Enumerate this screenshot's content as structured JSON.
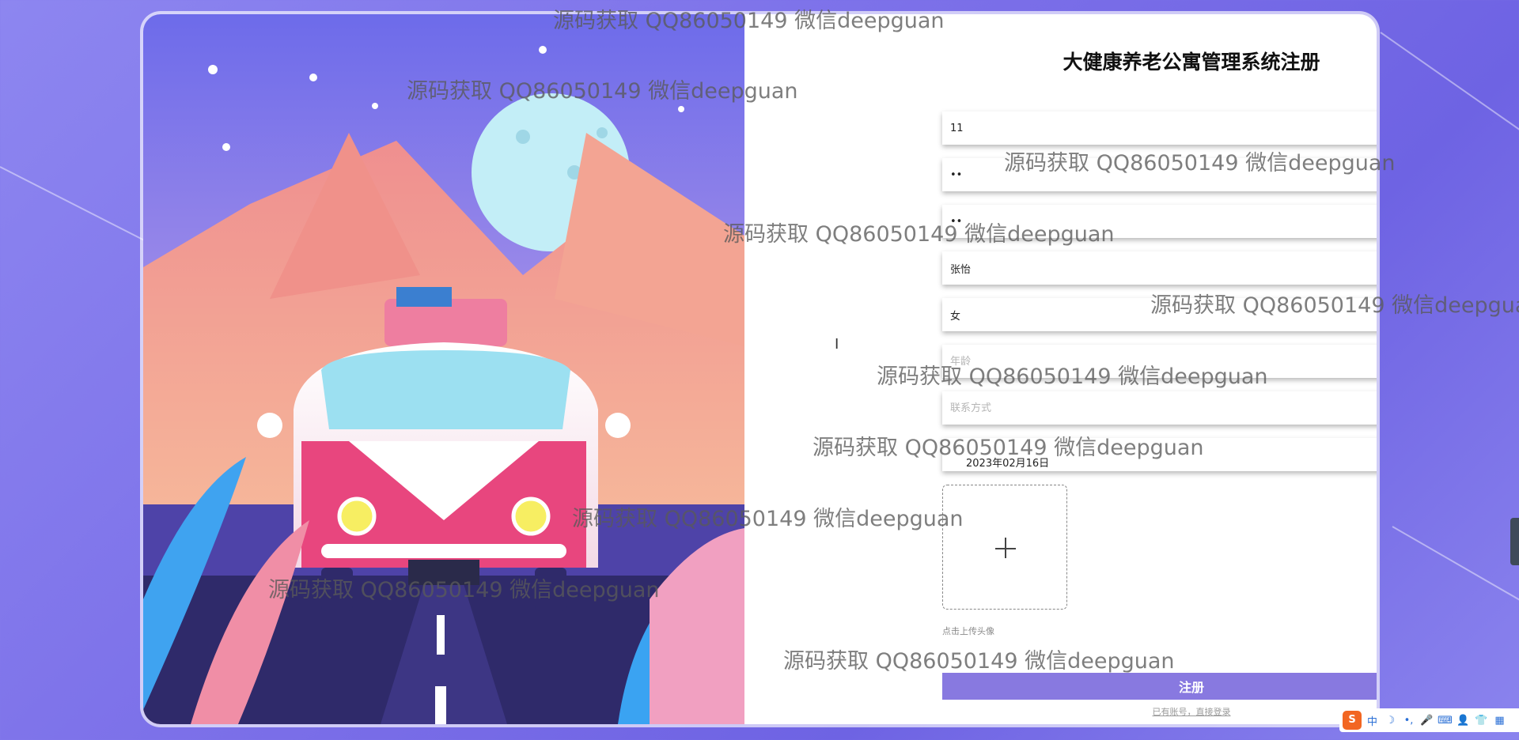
{
  "form": {
    "title": "大健康养老公寓管理系统注册",
    "fields": [
      {
        "name": "account",
        "value": "11",
        "placeholder": ""
      },
      {
        "name": "password",
        "value": "••",
        "placeholder": ""
      },
      {
        "name": "confirm-password",
        "value": "••",
        "placeholder": ""
      },
      {
        "name": "name",
        "value": "张怡",
        "placeholder": ""
      },
      {
        "name": "gender",
        "value": "女",
        "placeholder": ""
      },
      {
        "name": "age",
        "value": "",
        "placeholder": "年龄"
      },
      {
        "name": "contact",
        "value": "",
        "placeholder": "联系方式"
      }
    ],
    "date_value": "2023年02月16日",
    "upload_hint": "点击上传头像",
    "submit_label": "注册",
    "login_link": "已有账号，直接登录"
  },
  "watermark": "源码获取 QQ86050149 微信deepguan",
  "tray": {
    "icons": [
      "sogou-logo-icon",
      "chinese-mode-icon",
      "moon-icon",
      "punctuation-icon",
      "microphone-icon",
      "keyboard-icon",
      "user-icon",
      "shirt-icon",
      "grid-icon"
    ],
    "labels": [
      "S",
      "中",
      "☽",
      "•,",
      "🎤",
      "⌨",
      "👤",
      "👕",
      "▦"
    ]
  },
  "colors": {
    "accent": "#8879e0",
    "background": "#7a6ee8"
  }
}
